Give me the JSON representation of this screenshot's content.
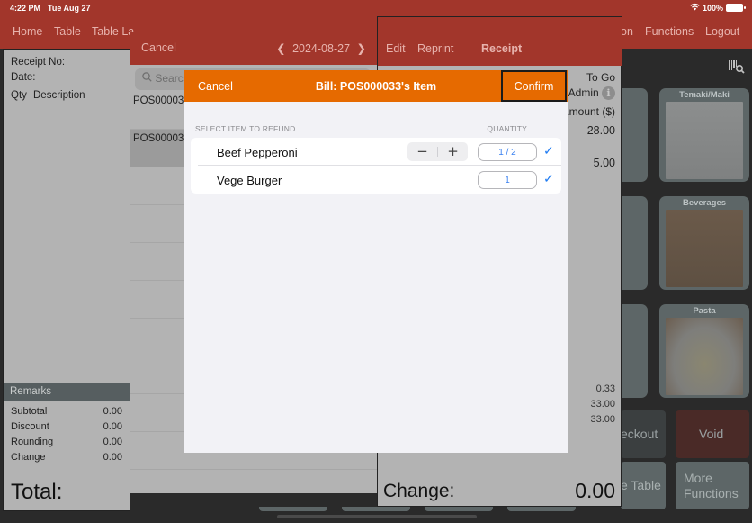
{
  "status_bar": {
    "time": "4:22 PM",
    "date": "Tue Aug 27",
    "battery": "100%"
  },
  "top_nav": {
    "items": [
      {
        "label": "Home"
      },
      {
        "label": "Table"
      },
      {
        "label": "Table La"
      },
      {
        "label": "on"
      },
      {
        "label": "Functions"
      },
      {
        "label": "Logout"
      }
    ]
  },
  "receipt_panel": {
    "receipt_no_label": "Receipt No:",
    "date_label": "Date:",
    "qty_label": "Qty",
    "description_label": "Description",
    "remarks_label": "Remarks",
    "summary": [
      {
        "label": "Subtotal",
        "value": "0.00"
      },
      {
        "label": "Discount",
        "value": "0.00"
      },
      {
        "label": "Rounding",
        "value": "0.00"
      },
      {
        "label": "Change",
        "value": "0.00"
      }
    ],
    "total_label": "Total:"
  },
  "bill_list": {
    "cancel_label": "Cancel",
    "date": "2024-08-27",
    "search_placeholder": "Search",
    "rows": [
      {
        "text": "POS00003"
      },
      {
        "text": "POS00003"
      }
    ]
  },
  "receipt_detail": {
    "edit_label": "Edit",
    "reprint_label": "Reprint",
    "title": "Receipt",
    "order_type": "To Go",
    "user": "Admin",
    "amount_header": "Amount ($)",
    "amounts": [
      "28.00",
      "5.00"
    ],
    "totals": [
      "0.33",
      "33.00",
      "33.00"
    ],
    "change_label": "Change:",
    "change_value": "0.00"
  },
  "categories": [
    {
      "label": "Temaki/Maki"
    },
    {
      "label": "Beverages"
    },
    {
      "label": "Pasta"
    }
  ],
  "actions": {
    "checkout": "eckout",
    "void": "Void",
    "table": "e Table",
    "more_functions_1": "More",
    "more_functions_2": "Functions"
  },
  "refund_modal": {
    "cancel_label": "Cancel",
    "title": "Bill: POS000033's Item",
    "confirm_label": "Confirm",
    "section_label": "SELECT ITEM TO REFUND",
    "quantity_header": "QUANTITY",
    "items": [
      {
        "name": "Beef Pepperoni",
        "quantity": "1 / 2",
        "selected": true,
        "has_stepper": true
      },
      {
        "name": "Vege Burger",
        "quantity": "1",
        "selected": true,
        "has_stepper": false
      }
    ],
    "stepper_minus": "−",
    "stepper_plus": "+",
    "check_glyph": "✓"
  },
  "colors": {
    "header_red": "#a2362b",
    "modal_orange": "#e66a00",
    "accent_blue": "#1f7bf2"
  }
}
